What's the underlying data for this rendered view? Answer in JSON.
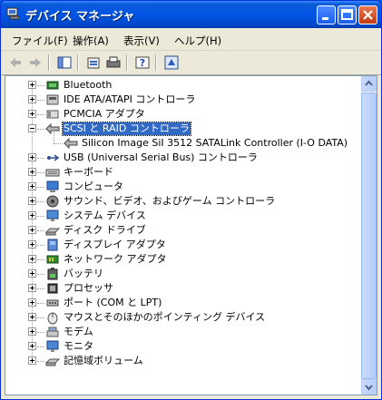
{
  "window": {
    "title": "デバイス マネージャ"
  },
  "menu": [
    "ファイル(F)",
    "操作(A)",
    "表示(V)",
    "ヘルプ(H)"
  ],
  "toolbar": [
    "back-icon",
    "forward-icon",
    "console-tree-icon",
    "properties-icon",
    "print-icon",
    "help-icon",
    "refresh-icon"
  ],
  "tree": {
    "items": [
      {
        "label": "Bluetooth",
        "icon": "bluetooth-icon",
        "expanded": false
      },
      {
        "label": "IDE ATA/ATAPI コントローラ",
        "icon": "ide-controller-icon",
        "expanded": false
      },
      {
        "label": "PCMCIA アダプタ",
        "icon": "pcmcia-icon",
        "expanded": false
      },
      {
        "label": "SCSI と RAID コントローラ",
        "icon": "scsi-icon",
        "expanded": true,
        "selected": true
      },
      {
        "label": "Silicon Image SiI 3512 SATALink Controller (I-O DATA)",
        "icon": "scsi-icon",
        "child": true
      },
      {
        "label": "USB (Universal Serial Bus) コントローラ",
        "icon": "usb-icon",
        "expanded": false
      },
      {
        "label": "キーボード",
        "icon": "keyboard-icon",
        "expanded": false
      },
      {
        "label": "コンピュータ",
        "icon": "computer-icon",
        "expanded": false
      },
      {
        "label": "サウンド、ビデオ、およびゲーム コントローラ",
        "icon": "sound-icon",
        "expanded": false
      },
      {
        "label": "システム デバイス",
        "icon": "system-device-icon",
        "expanded": false
      },
      {
        "label": "ディスク ドライブ",
        "icon": "disk-drive-icon",
        "expanded": false
      },
      {
        "label": "ディスプレイ アダプタ",
        "icon": "display-adapter-icon",
        "expanded": false
      },
      {
        "label": "ネットワーク アダプタ",
        "icon": "network-adapter-icon",
        "expanded": false
      },
      {
        "label": "バッテリ",
        "icon": "battery-icon",
        "expanded": false
      },
      {
        "label": "プロセッサ",
        "icon": "processor-icon",
        "expanded": false
      },
      {
        "label": "ポート (COM と LPT)",
        "icon": "port-icon",
        "expanded": false
      },
      {
        "label": "マウスとそのほかのポインティング デバイス",
        "icon": "mouse-icon",
        "expanded": false
      },
      {
        "label": "モデム",
        "icon": "modem-icon",
        "expanded": false
      },
      {
        "label": "モニタ",
        "icon": "monitor-icon",
        "expanded": false
      },
      {
        "label": "記憶域ボリューム",
        "icon": "storage-volume-icon",
        "expanded": false
      }
    ]
  }
}
